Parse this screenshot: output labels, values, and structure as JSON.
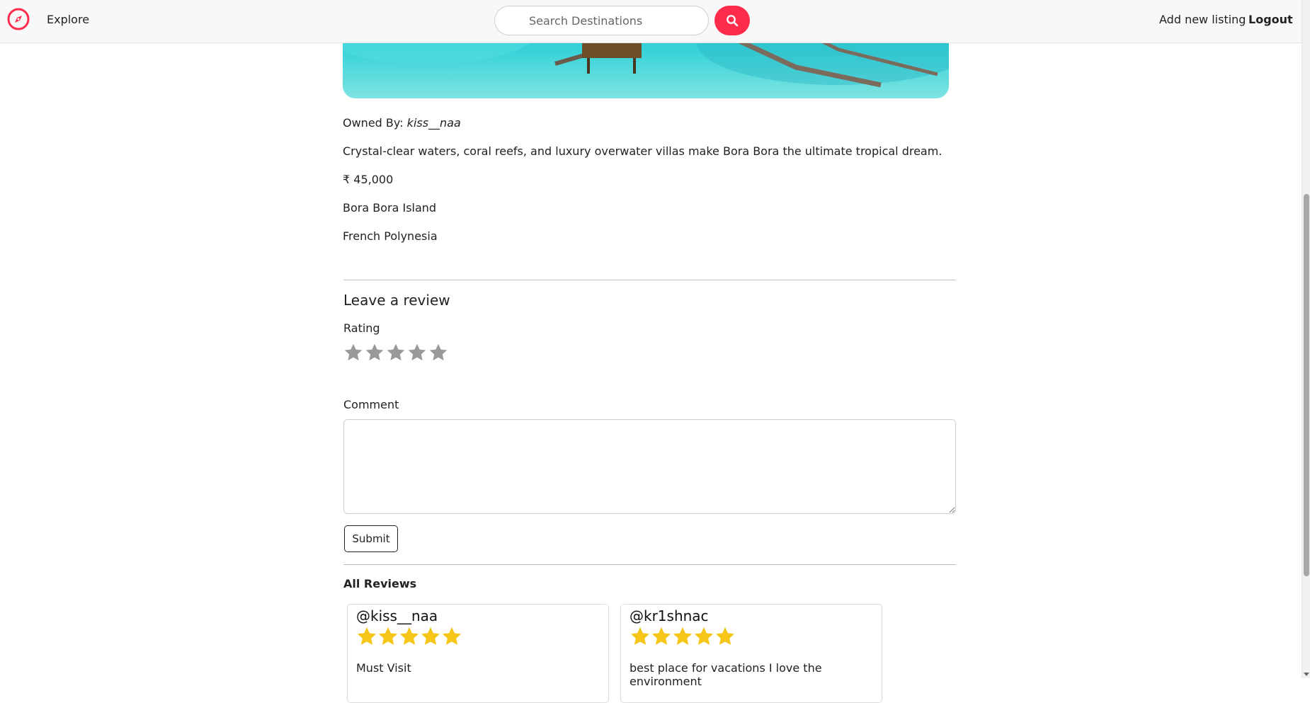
{
  "navbar": {
    "logo_icon": "compass-icon",
    "explore_label": "Explore",
    "search_placeholder": "Search Destinations",
    "search_icon": "search-icon",
    "add_listing_label": "Add new listing",
    "logout_label": "Logout",
    "accent_color": "#fe2c4a"
  },
  "listing": {
    "owner_prefix": "Owned By:",
    "owner_name": "kiss__naa",
    "description": "Crystal-clear waters, coral reefs, and luxury overwater villas make Bora Bora the ultimate tropical dream.",
    "price": "₹ 45,000",
    "location": "Bora Bora Island",
    "country": "French Polynesia"
  },
  "review_form": {
    "heading": "Leave a review",
    "rating_label": "Rating",
    "rating_value": 0,
    "rating_max": 5,
    "comment_label": "Comment",
    "comment_value": "",
    "submit_label": "Submit"
  },
  "reviews": {
    "heading": "All Reviews",
    "items": [
      {
        "author": "@kiss__naa",
        "rating": 5,
        "comment": "Must Visit"
      },
      {
        "author": "@kr1shnac",
        "rating": 5,
        "comment": "best place for vacations I love the environment"
      }
    ],
    "star_color": "#f5c518",
    "empty_star_color": "#999999"
  }
}
